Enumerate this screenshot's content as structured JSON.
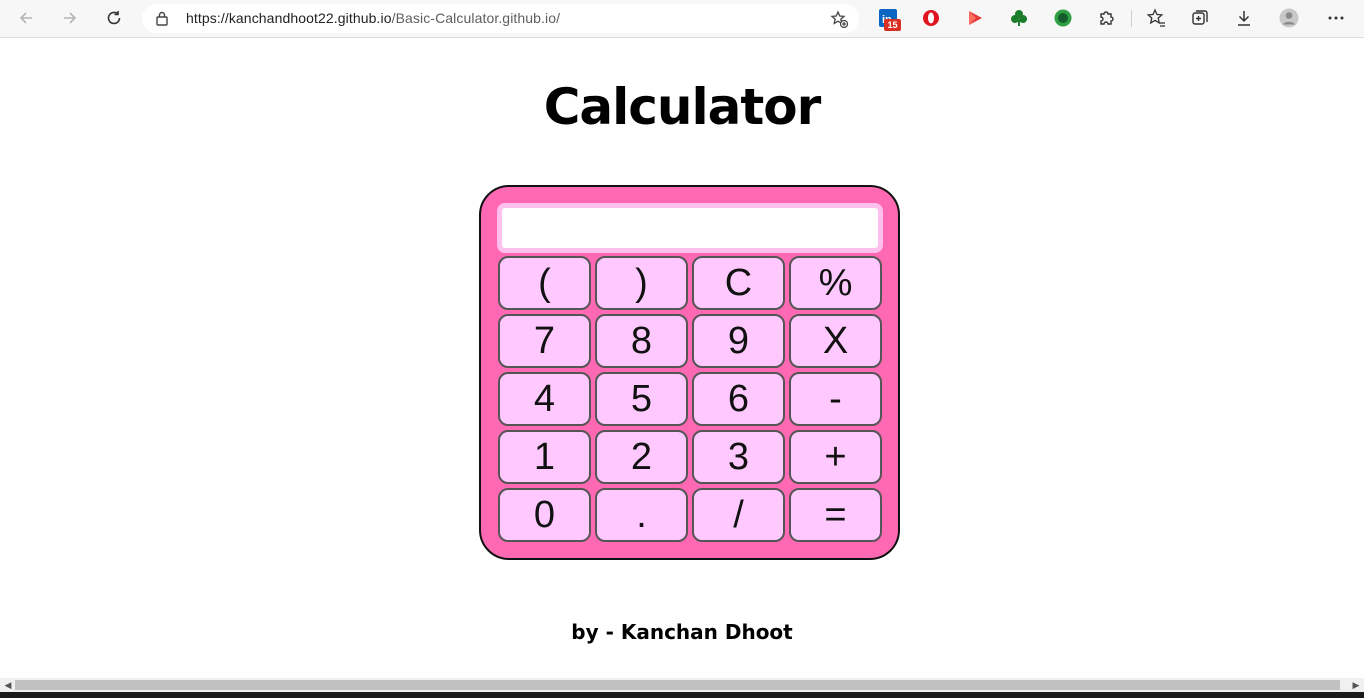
{
  "browser": {
    "url_host": "https://kanchandhoot22.github.io",
    "url_path": "/Basic-Calculator.github.io/",
    "extensions": [
      {
        "name": "linkedin-ext-icon",
        "color": "#0a66c2"
      },
      {
        "name": "opera-ext-icon",
        "color": "#e0141e"
      },
      {
        "name": "play-ext-icon",
        "color": "#e53935"
      },
      {
        "name": "clover-ext-icon",
        "color": "#1b7d2b"
      },
      {
        "name": "green-circle-ext-icon",
        "color": "#2ea043"
      }
    ],
    "linkedin_badge": "15"
  },
  "page": {
    "title": "Calculator",
    "footer": "by - Kanchan Dhoot"
  },
  "calculator": {
    "display_value": "",
    "body_color": "#ff69b4",
    "key_color": "#ffc8ff",
    "keys": [
      "(",
      ")",
      "C",
      "%",
      "7",
      "8",
      "9",
      "X",
      "4",
      "5",
      "6",
      "-",
      "1",
      "2",
      "3",
      "+",
      "0",
      ".",
      "/",
      "="
    ]
  }
}
